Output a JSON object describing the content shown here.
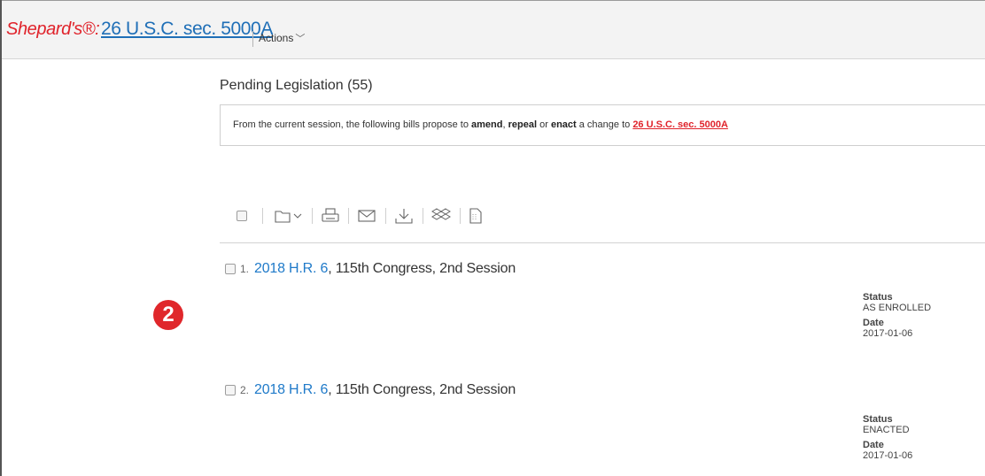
{
  "header": {
    "shepards_label": "Shepard's®:",
    "citation": "26 U.S.C. sec. 5000A",
    "actions_label": "Actions"
  },
  "section": {
    "title": "Pending Legislation (55)"
  },
  "info_box": {
    "prefix": "From the current session, the following bills propose to ",
    "word_amend": "amend",
    "sep1": ", ",
    "word_repeal": "repeal",
    "sep2": " or ",
    "word_enact": "enact",
    "suffix": " a change to ",
    "link": "26 U.S.C. sec. 5000A"
  },
  "toolbar": {
    "icons": [
      "checkbox",
      "folder-icon",
      "chevron-down-icon",
      "print-icon",
      "email-icon",
      "download-icon",
      "dropbox-icon",
      "document-icon"
    ]
  },
  "results": [
    {
      "number": "1.",
      "title": "2018 H.R. 6",
      "rest": ", 115th Congress, 2nd Session",
      "status_label": "Status",
      "status": "AS ENROLLED",
      "date_label": "Date",
      "date": "2017-01-06"
    },
    {
      "number": "2.",
      "title": "2018 H.R. 6",
      "rest": ", 115th Congress, 2nd Session",
      "status_label": "Status",
      "status": "ENACTED",
      "date_label": "Date",
      "date": "2017-01-06"
    }
  ],
  "callout": {
    "badge": "2",
    "color": "#e0272b"
  },
  "colors": {
    "accent_red": "#e0232b",
    "link_blue": "#1f7ac9",
    "header_bg": "#f3f3f3"
  }
}
